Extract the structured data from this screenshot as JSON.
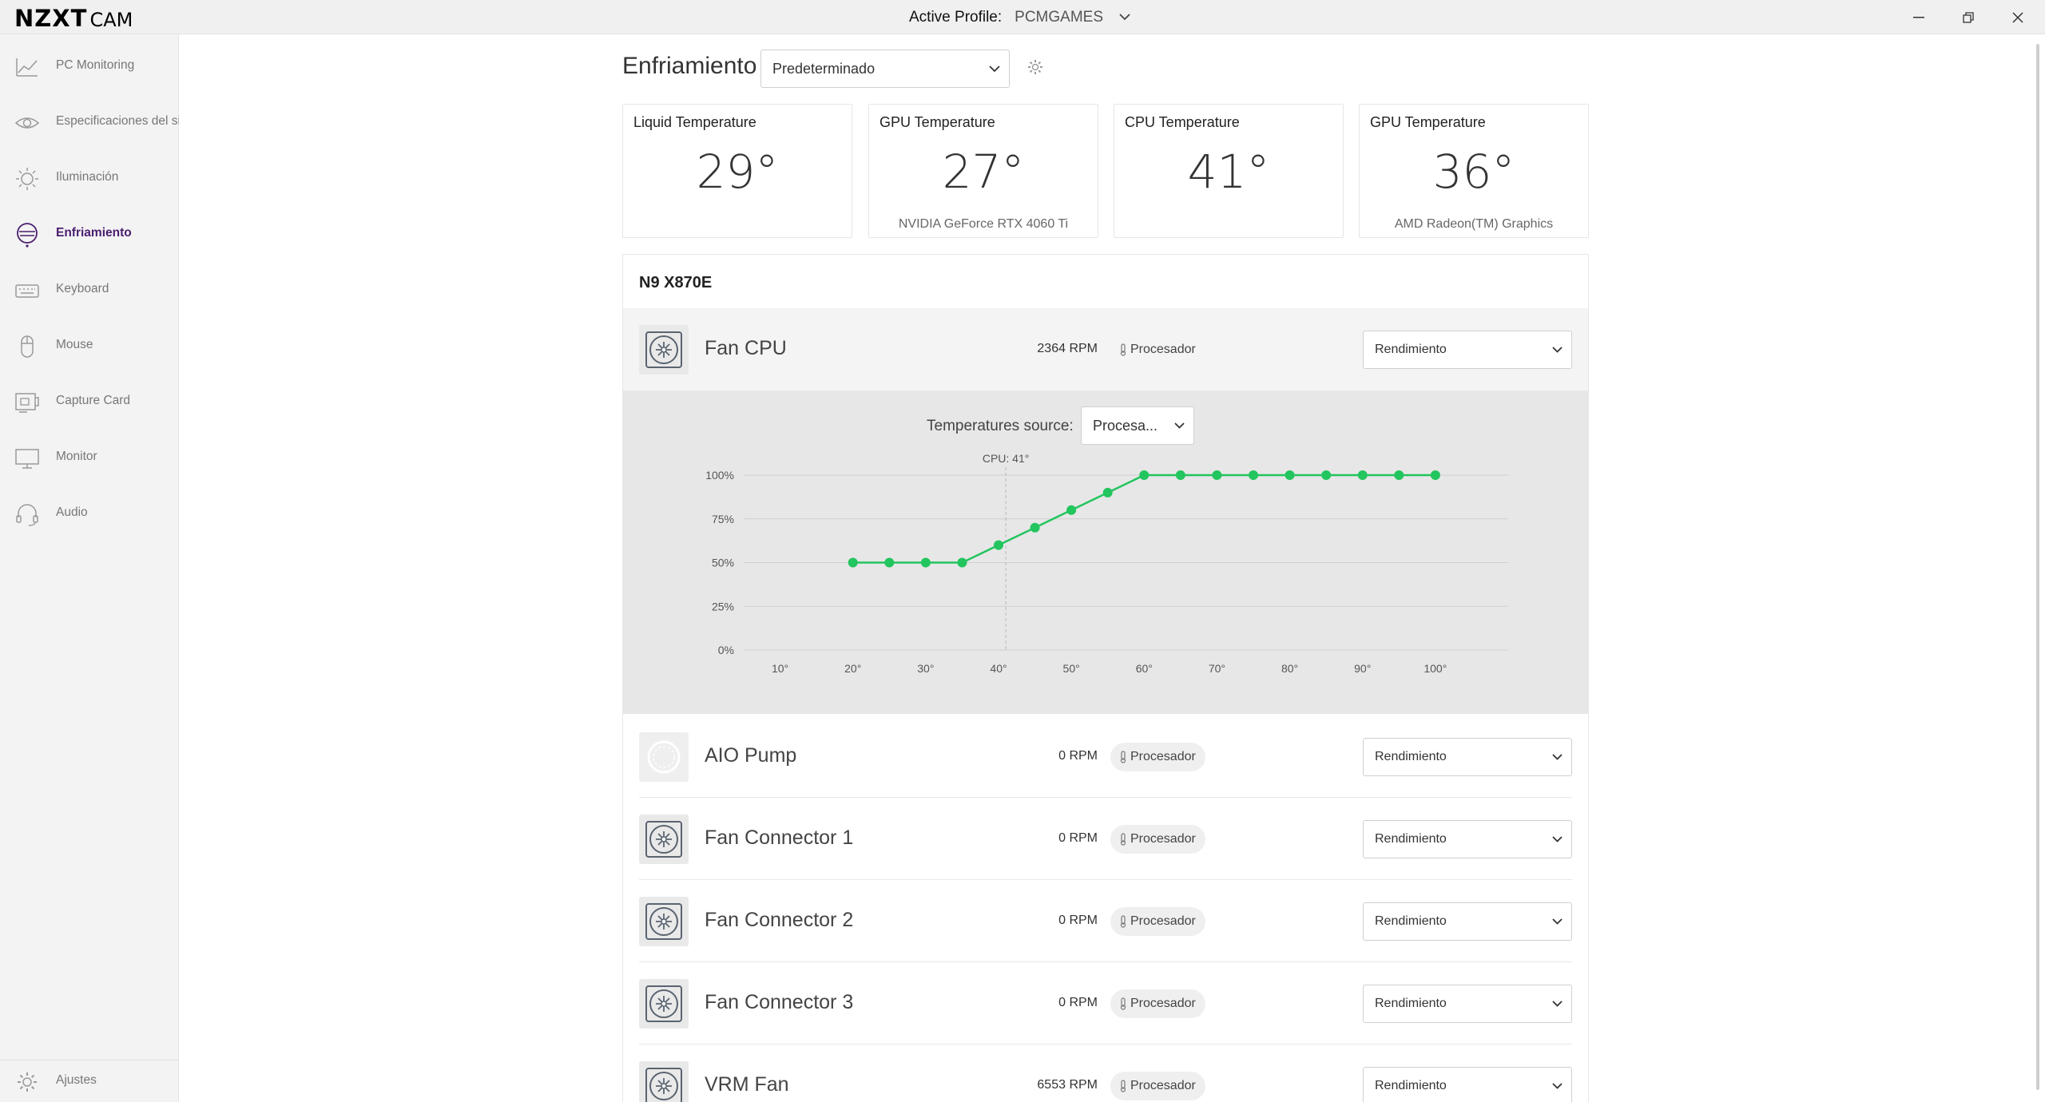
{
  "app": {
    "logo_bold": "NZXT",
    "logo_light": "CAM",
    "active_profile_label": "Active Profile:",
    "active_profile_value": "PCMGAMES"
  },
  "sidebar": {
    "items": [
      {
        "label": "PC Monitoring",
        "icon": "chart-line-icon"
      },
      {
        "label": "Especificaciones del sis",
        "icon": "eye-icon"
      },
      {
        "label": "Iluminación",
        "icon": "sun-icon"
      },
      {
        "label": "Enfriamiento",
        "icon": "cooling-icon",
        "active": true
      },
      {
        "label": "Keyboard",
        "icon": "keyboard-icon"
      },
      {
        "label": "Mouse",
        "icon": "mouse-icon"
      },
      {
        "label": "Capture Card",
        "icon": "capture-card-icon"
      },
      {
        "label": "Monitor",
        "icon": "monitor-icon"
      },
      {
        "label": "Audio",
        "icon": "headset-icon"
      }
    ],
    "settings_label": "Ajustes"
  },
  "header": {
    "title": "Enfriamiento",
    "preset": "Predeterminado"
  },
  "temps": [
    {
      "title": "Liquid Temperature",
      "value": "29°",
      "subtitle": ""
    },
    {
      "title": "GPU Temperature",
      "value": "27°",
      "subtitle": "NVIDIA GeForce RTX 4060 Ti"
    },
    {
      "title": "CPU Temperature",
      "value": "41°",
      "subtitle": ""
    },
    {
      "title": "GPU Temperature",
      "value": "36°",
      "subtitle": "AMD Radeon(TM) Graphics"
    }
  ],
  "device": {
    "name": "N9 X870E",
    "fans": [
      {
        "name": "Fan CPU",
        "rpm": "2364 RPM",
        "source": "Procesador",
        "mode": "Rendimiento"
      },
      {
        "name": "AIO Pump",
        "rpm": "0 RPM",
        "source": "Procesador",
        "mode": "Rendimiento"
      },
      {
        "name": "Fan Connector 1",
        "rpm": "0 RPM",
        "source": "Procesador",
        "mode": "Rendimiento"
      },
      {
        "name": "Fan Connector 2",
        "rpm": "0 RPM",
        "source": "Procesador",
        "mode": "Rendimiento"
      },
      {
        "name": "Fan Connector 3",
        "rpm": "0 RPM",
        "source": "Procesador",
        "mode": "Rendimiento"
      },
      {
        "name": "VRM Fan",
        "rpm": "6553 RPM",
        "source": "Procesador",
        "mode": "Rendimiento"
      }
    ],
    "temperatures_source_label": "Temperatures source:",
    "temperatures_source_value": "Procesa..."
  },
  "chart_data": {
    "type": "line",
    "x": [
      20,
      25,
      30,
      35,
      40,
      45,
      50,
      55,
      60,
      65,
      70,
      75,
      80,
      85,
      90,
      95,
      100
    ],
    "series": [
      {
        "values": [
          50,
          50,
          50,
          50,
          60,
          70,
          80,
          90,
          100,
          100,
          100,
          100,
          100,
          100,
          100,
          100,
          100
        ]
      }
    ],
    "x_ticks": [
      "10°",
      "20°",
      "30°",
      "40°",
      "50°",
      "60°",
      "70°",
      "80°",
      "90°",
      "100°"
    ],
    "y_ticks": [
      "0%",
      "25%",
      "50%",
      "75%",
      "100%"
    ],
    "xlim": [
      5,
      110
    ],
    "ylim": [
      0,
      100
    ],
    "marker_x": 41,
    "marker_label": "CPU: 41°",
    "grid": true,
    "color": "#22c55e"
  }
}
